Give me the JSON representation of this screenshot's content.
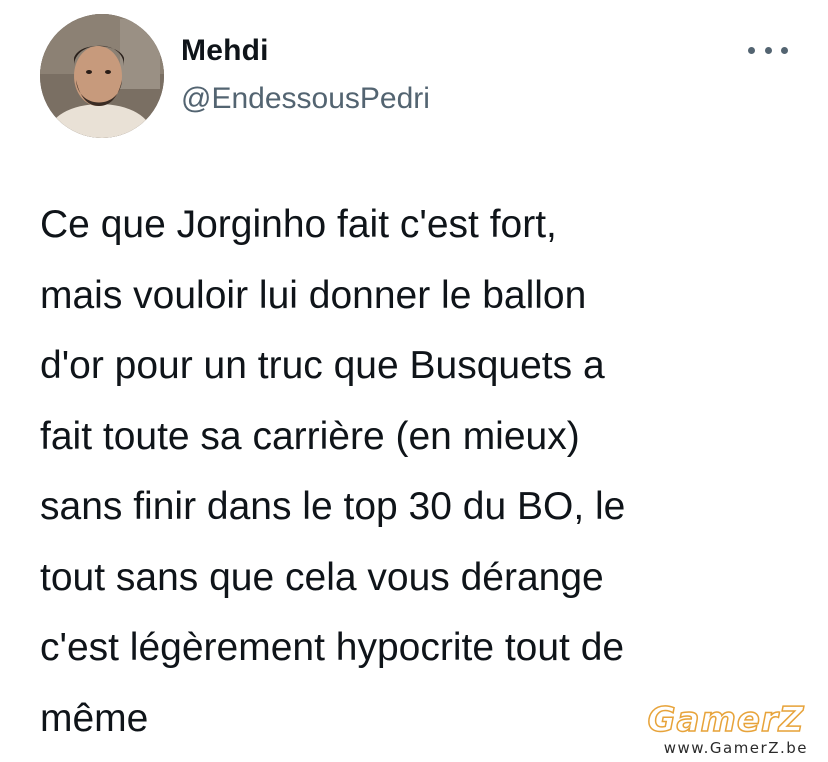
{
  "author": {
    "display_name": "Mehdi",
    "handle": "@EndessousPedri"
  },
  "tweet": {
    "text": "Ce que Jorginho fait c'est fort,\nmais vouloir lui donner le ballon\nd'or pour un truc que Busquets a\nfait toute sa carrière (en mieux)\nsans finir dans le top 30 du BO, le\ntout sans que cela vous dérange\nc'est légèrement hypocrite tout de\nmême"
  },
  "icons": {
    "more": "more-horizontal-icon"
  },
  "watermark": {
    "logo": "GamerZ",
    "url": "www.GamerZ.be",
    "color": "#e7a33a"
  }
}
